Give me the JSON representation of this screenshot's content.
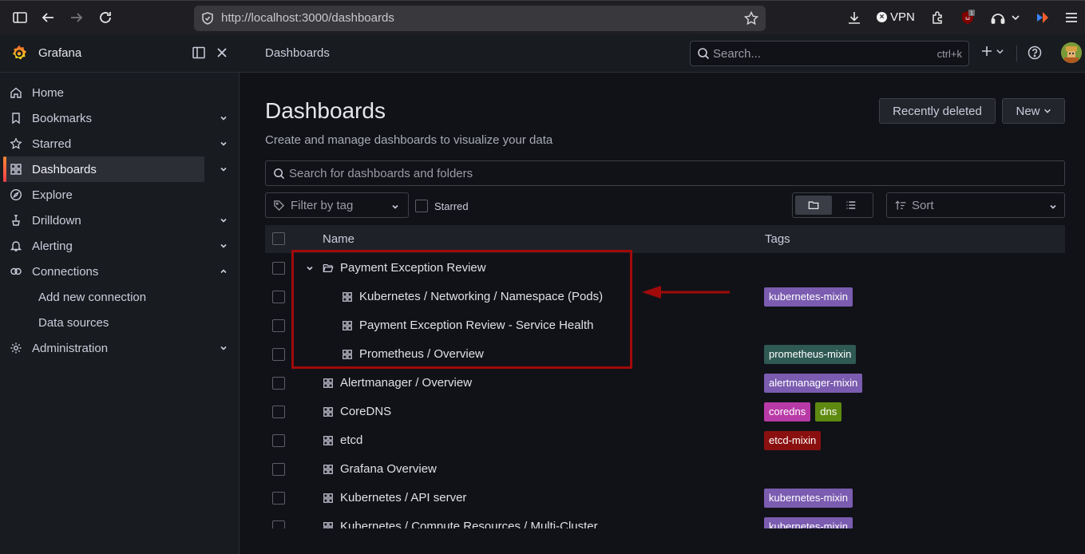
{
  "browser": {
    "url": "http://localhost:3000/dashboards",
    "vpn_label": "VPN",
    "badge": "1"
  },
  "topbar": {
    "brand": "Grafana",
    "breadcrumb": "Dashboards",
    "search_placeholder": "Search...",
    "search_shortcut": "ctrl+k",
    "plus": "+"
  },
  "sidebar": {
    "items": [
      {
        "label": "Home",
        "icon": "home-icon"
      },
      {
        "label": "Bookmarks",
        "icon": "bookmark-icon"
      },
      {
        "label": "Starred",
        "icon": "star-icon"
      },
      {
        "label": "Dashboards",
        "icon": "apps-icon"
      },
      {
        "label": "Explore",
        "icon": "compass-icon"
      },
      {
        "label": "Drilldown",
        "icon": "drilldown-icon"
      },
      {
        "label": "Alerting",
        "icon": "bell-icon"
      },
      {
        "label": "Connections",
        "icon": "link-icon"
      },
      {
        "label": "Add new connection"
      },
      {
        "label": "Data sources"
      },
      {
        "label": "Administration",
        "icon": "cog-icon"
      }
    ]
  },
  "page": {
    "title": "Dashboards",
    "subtitle": "Create and manage dashboards to visualize your data",
    "recently_deleted": "Recently deleted",
    "new_button": "New",
    "search_placeholder": "Search for dashboards and folders",
    "tag_filter_placeholder": "Filter by tag",
    "starred_label": "Starred",
    "sort_placeholder": "Sort"
  },
  "table": {
    "col_name": "Name",
    "col_tags": "Tags",
    "rows": [
      {
        "name": "Payment Exception Review",
        "kind": "folder",
        "tags": []
      },
      {
        "name": "Kubernetes / Networking / Namespace (Pods)",
        "kind": "dashboard",
        "tags": [
          "kubernetes-mixin"
        ]
      },
      {
        "name": "Payment Exception Review - Service Health",
        "kind": "dashboard",
        "tags": []
      },
      {
        "name": "Prometheus / Overview",
        "kind": "dashboard",
        "tags": [
          "prometheus-mixin"
        ]
      },
      {
        "name": "Alertmanager / Overview",
        "kind": "dashboard",
        "tags": [
          "alertmanager-mixin"
        ]
      },
      {
        "name": "CoreDNS",
        "kind": "dashboard",
        "tags": [
          "coredns",
          "dns"
        ]
      },
      {
        "name": "etcd",
        "kind": "dashboard",
        "tags": [
          "etcd-mixin"
        ]
      },
      {
        "name": "Grafana Overview",
        "kind": "dashboard",
        "tags": []
      },
      {
        "name": "Kubernetes / API server",
        "kind": "dashboard",
        "tags": [
          "kubernetes-mixin"
        ]
      },
      {
        "name": "Kubernetes / Compute Resources / Multi-Cluster",
        "kind": "dashboard",
        "tags": [
          "kubernetes-mixin"
        ]
      }
    ]
  },
  "tag_colors": {
    "kubernetes-mixin": "#7b5cb0",
    "prometheus-mixin": "#2f5953",
    "alertmanager-mixin": "#7b5cb0",
    "coredns": "#b83aa7",
    "dns": "#5f8a11",
    "etcd-mixin": "#8a1010"
  },
  "colors": {
    "accent_gradient_start": "#ff8833",
    "accent_gradient_end": "#f53e4c",
    "highlight_border": "#a10a0a"
  }
}
